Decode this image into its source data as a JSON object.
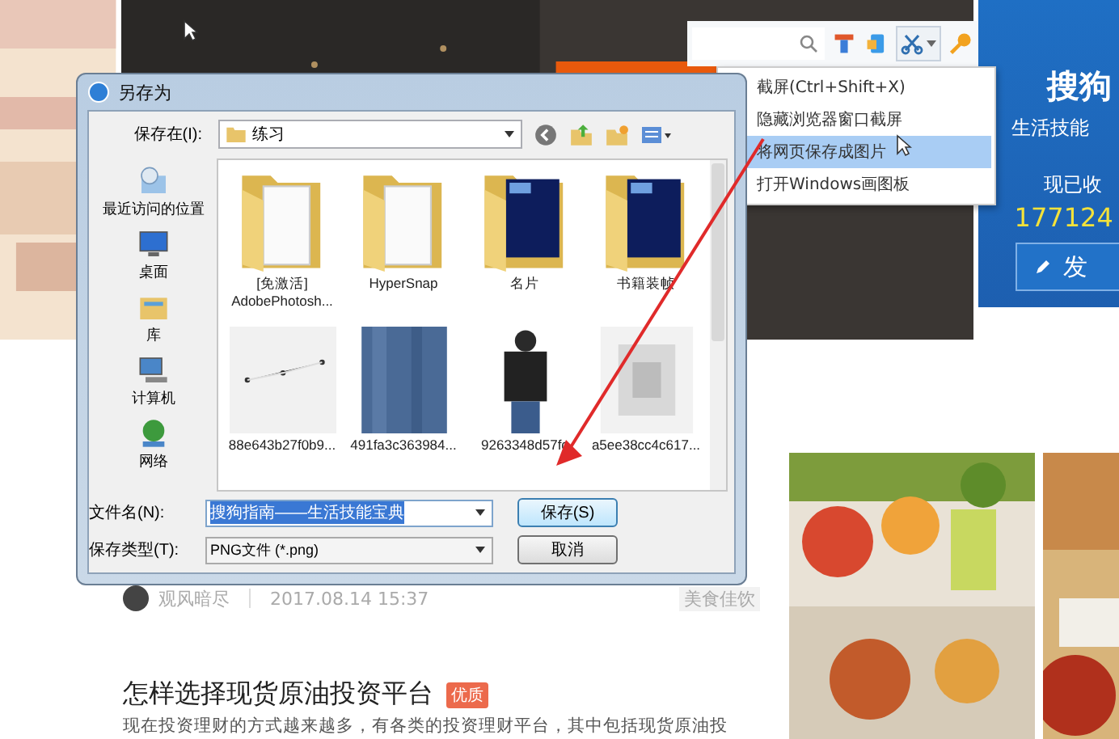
{
  "side_panel": {
    "title": "搜狗",
    "subtitle": "生活技能",
    "count_label": "现已收",
    "count": "177124",
    "button": "发"
  },
  "article_meta": {
    "author": "观风暗尽",
    "time": "2017.08.14 15:37",
    "tag": "美食佳饮"
  },
  "article": {
    "title": "怎样选择现货原油投资平台",
    "badge": "优质",
    "excerpt": "现在投资理财的方式越来越多，有各类的投资理财平台，其中包括现货原油投"
  },
  "toolbar": {
    "menu": [
      {
        "label": "截屏(Ctrl+Shift+X)",
        "selected": false
      },
      {
        "label": "隐藏浏览器窗口截屏",
        "selected": false
      },
      {
        "label": "将网页保存成图片",
        "selected": true
      },
      {
        "label": "打开Windows画图板",
        "selected": false
      }
    ]
  },
  "dialog": {
    "title": "另存为",
    "location_label": "保存在(I):",
    "location": "练习",
    "places": [
      {
        "label": "最近访问的位置",
        "kind": "recent"
      },
      {
        "label": "桌面",
        "kind": "desktop"
      },
      {
        "label": "库",
        "kind": "library"
      },
      {
        "label": "计算机",
        "kind": "computer"
      },
      {
        "label": "网络",
        "kind": "network"
      }
    ],
    "files": [
      {
        "name": "[免激活]\nAdobePhotosh...",
        "kind": "folder"
      },
      {
        "name": "HyperSnap",
        "kind": "folder"
      },
      {
        "name": "名片",
        "kind": "ps_folder"
      },
      {
        "name": "书籍装帧",
        "kind": "ps_folder"
      },
      {
        "name": "88e643b27f0b9..."
      },
      {
        "name": "491fa3c363984..."
      },
      {
        "name": "9263348d57fc"
      },
      {
        "name": "a5ee38cc4c617..."
      }
    ],
    "filename_label": "文件名(N):",
    "filename": "搜狗指南——生活技能宝典",
    "filetype_label": "保存类型(T):",
    "filetype": "PNG文件 (*.png)",
    "buttons": [
      {
        "label": "保存(S)",
        "kind": "default"
      },
      {
        "label": "取消",
        "kind": "normal"
      }
    ]
  }
}
